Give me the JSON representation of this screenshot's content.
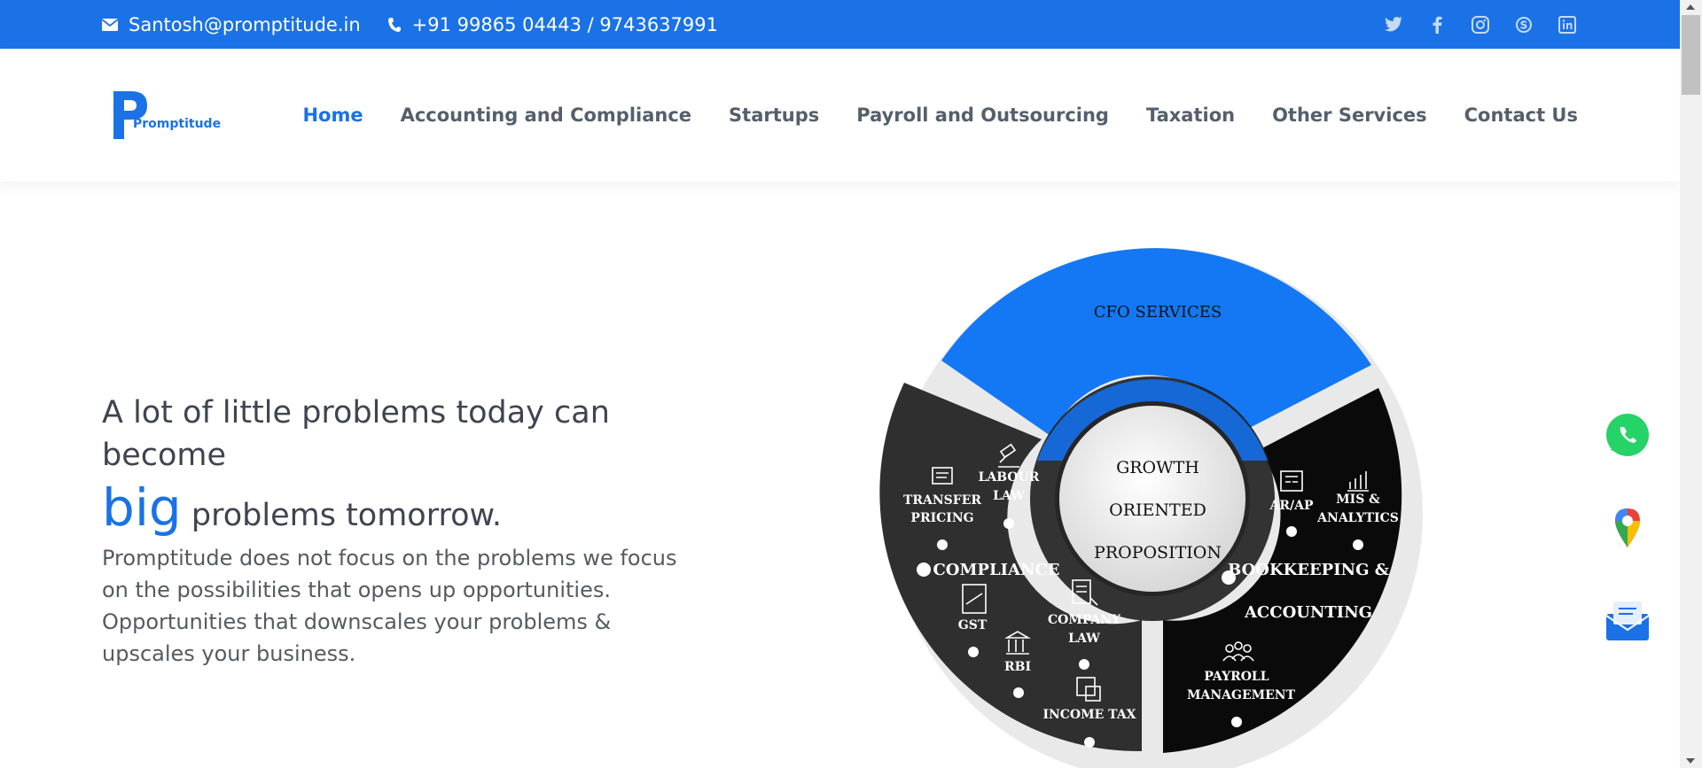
{
  "topbar": {
    "email": "Santosh@promptitude.in",
    "phone": "+91 99865 04443 / 9743637991",
    "social": [
      "twitter-icon",
      "facebook-icon",
      "instagram-icon",
      "skype-icon",
      "linkedin-icon"
    ]
  },
  "logo": {
    "text": "Promptitude"
  },
  "nav": {
    "items": [
      "Home",
      "Accounting and Compliance",
      "Startups",
      "Payroll and Outsourcing",
      "Taxation",
      "Other Services",
      "Contact Us"
    ]
  },
  "hero": {
    "line1": "A lot of little problems today can become",
    "big": "big",
    "line2": "problems tomorrow.",
    "body": "Promptitude does not focus on the problems we focus on the possibilities that opens up opportunities. Opportunities that downscales your problems & upscales your business."
  },
  "wheel": {
    "top": "CFO SERVICES",
    "center": [
      "GROWTH",
      "ORIENTED",
      "PROPOSITION"
    ],
    "compliance": {
      "title": "COMPLIANCE",
      "items": [
        "TRANSFER",
        "PRICING",
        "LABOUR",
        "LAW",
        "GST",
        "RBI",
        "COMPANY",
        "LAW",
        "INCOME TAX"
      ]
    },
    "bookkeeping": {
      "title1": "BOOKKEEPING &",
      "title2": "ACCOUNTING",
      "items": [
        "AR/AP",
        "MIS &",
        "ANALYTICS",
        "PAYROLL",
        "MANAGEMENT"
      ]
    }
  },
  "floating": [
    "whatsapp-icon",
    "map-pin-icon",
    "mail-icon"
  ],
  "colors": {
    "brand": "#1a72e6",
    "dark_segment": "#2f2f2f",
    "black_segment": "#0a0a0a"
  }
}
